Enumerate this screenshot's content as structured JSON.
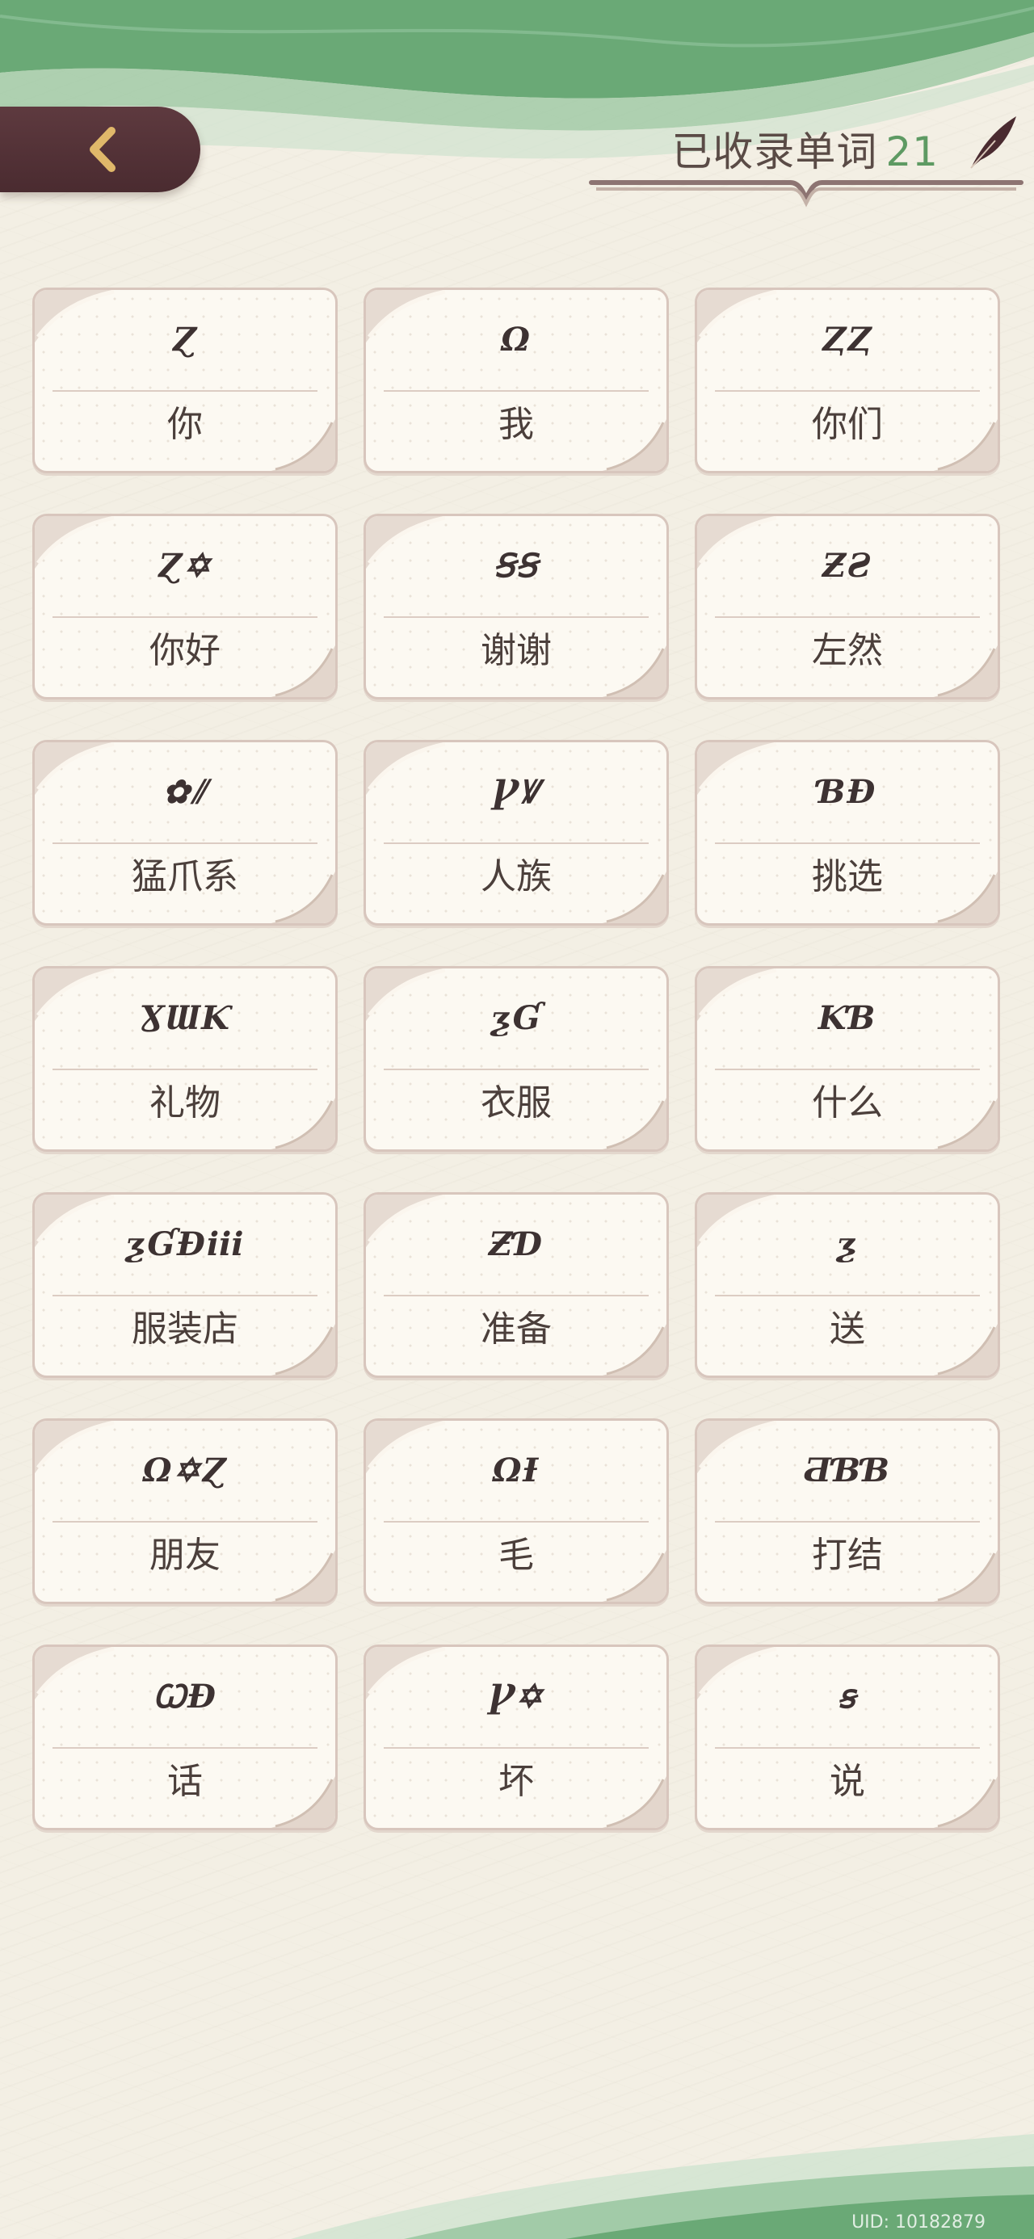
{
  "header": {
    "collected_label": "已收录单词",
    "collected_count": "21"
  },
  "words": [
    {
      "rune": "Ɀ",
      "meaning": "你"
    },
    {
      "rune": "Ω",
      "meaning": "我"
    },
    {
      "rune": "ⱫⱫ",
      "meaning": "你们"
    },
    {
      "rune": "Ɀ✡",
      "meaning": "你好"
    },
    {
      "rune": "ꞨꞨ",
      "meaning": "谢谢"
    },
    {
      "rune": "ƵƧ",
      "meaning": "左然"
    },
    {
      "rune": "✿⫽",
      "meaning": "猛爪系"
    },
    {
      "rune": "ꝨꝞ",
      "meaning": "人族"
    },
    {
      "rune": "ƁƉ",
      "meaning": "挑选"
    },
    {
      "rune": "ƔƜƘ",
      "meaning": "礼物"
    },
    {
      "rune": "ƺƓ",
      "meaning": "衣服"
    },
    {
      "rune": "ƘƁ",
      "meaning": "什么"
    },
    {
      "rune": "ƺƓƉⅲ",
      "meaning": "服装店"
    },
    {
      "rune": "ƵƊ",
      "meaning": "准备"
    },
    {
      "rune": "ƺ",
      "meaning": "送"
    },
    {
      "rune": "Ω✡Ɀ",
      "meaning": "朋友"
    },
    {
      "rune": "ΩƗ",
      "meaning": "毛"
    },
    {
      "rune": "ƋƁƁ",
      "meaning": "打结"
    },
    {
      "rune": "ꞶƉ",
      "meaning": "话"
    },
    {
      "rune": "Ꝩ✡",
      "meaning": "坏"
    },
    {
      "rune": "ꞩ",
      "meaning": "说"
    }
  ],
  "footer": {
    "uid": "UID: 10182879"
  },
  "colors": {
    "accent_green": "#5e9a63",
    "back_button": "#4a2b30",
    "card_border": "#d8c6bd"
  }
}
